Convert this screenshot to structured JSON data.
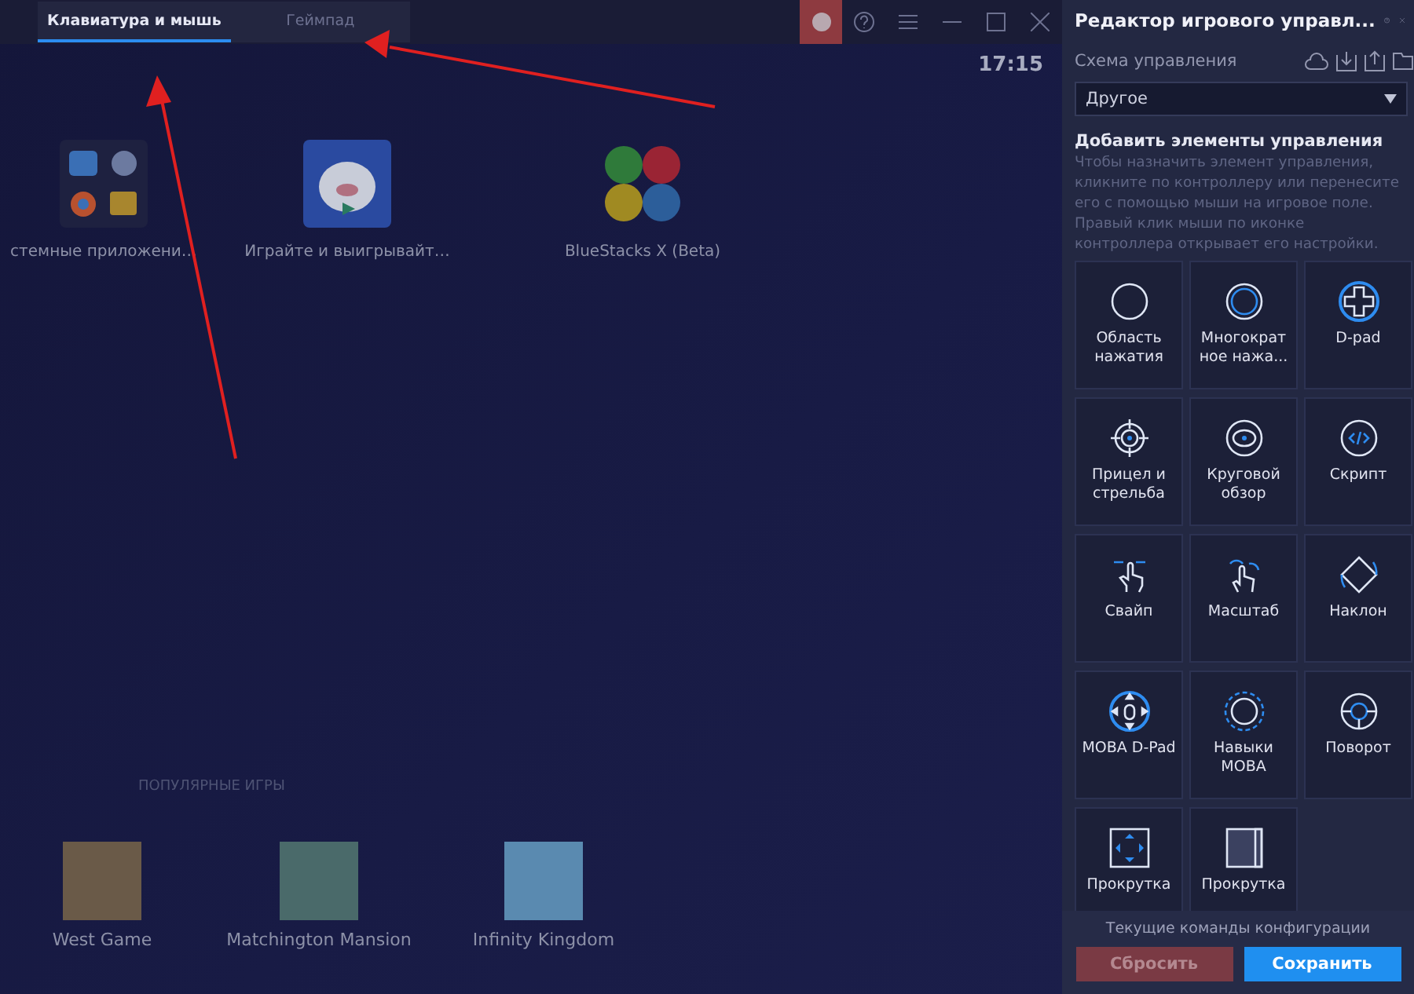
{
  "tabs": [
    {
      "label": "Клавиатура и мышь",
      "selected": true
    },
    {
      "label": "Геймпад",
      "selected": false
    }
  ],
  "clock": "17:15",
  "apps": [
    {
      "kind": "folder",
      "label": "стемные приложени…"
    },
    {
      "kind": "pig",
      "label": "Играйте и выигрывайт…"
    },
    {
      "kind": "logo",
      "label": "BlueStacks X (Beta)"
    }
  ],
  "popular": {
    "heading": "ПОПУЛЯРНЫЕ ИГРЫ",
    "games": [
      {
        "label": "West Game"
      },
      {
        "label": "Matchington Mansion"
      },
      {
        "label": "Infinity Kingdom"
      }
    ]
  },
  "panel": {
    "title": "Редактор игрового управл...",
    "scheme_label": "Схема управления",
    "scheme_value": "Другое",
    "add_heading": "Добавить элементы управления",
    "add_hint": "Чтобы назначить элемент управления, кликните по контроллеру или перенесите его с помощью мыши на игровое поле. Правый клик мыши по иконке контроллера открывает его настройки.",
    "tiles": [
      {
        "kind": "tap",
        "label": "Область нажатия"
      },
      {
        "kind": "multitap",
        "label": "Многократ ное нажа..."
      },
      {
        "kind": "dpad",
        "label": "D-pad"
      },
      {
        "kind": "aim",
        "label": "Прицел и стрельба"
      },
      {
        "kind": "look",
        "label": "Круговой обзор"
      },
      {
        "kind": "script",
        "label": "Скрипт"
      },
      {
        "kind": "swipe",
        "label": "Свайп"
      },
      {
        "kind": "zoom",
        "label": "Масштаб"
      },
      {
        "kind": "tilt",
        "label": "Наклон"
      },
      {
        "kind": "mobadpad",
        "label": "MOBA D-Pad"
      },
      {
        "kind": "skills",
        "label": "Навыки MOBA"
      },
      {
        "kind": "rotate",
        "label": "Поворот"
      },
      {
        "kind": "edgescroll",
        "label": "Прокрутка"
      },
      {
        "kind": "screenscroll",
        "label": "Прокрутка"
      }
    ],
    "footer_label": "Текущие команды конфигурации",
    "reset": "Сбросить",
    "save": "Сохранить"
  }
}
